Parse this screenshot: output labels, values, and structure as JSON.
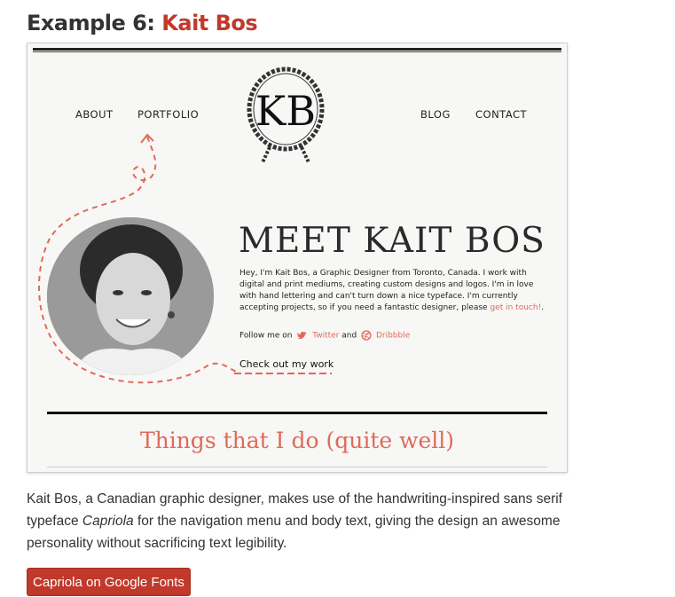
{
  "heading": {
    "prefix": "Example 6: ",
    "name": "Kait Bos"
  },
  "site": {
    "nav": {
      "about": "ABOUT",
      "portfolio": "PORTFOLIO",
      "blog": "BLOG",
      "contact": "CONTACT"
    },
    "logo_text": "KB",
    "meet_title": "MEET KAIT BOS",
    "bio_text": "Hey, I'm Kait Bos, a Graphic Designer from Toronto, Canada. I work with digital and print mediums, creating custom designs and logos. I'm in love with hand lettering and can't turn down a nice typeface. I'm currently accepting projects, so if you need a fantastic designer, please ",
    "bio_link": "get in touch!",
    "bio_end": ".",
    "follow_prefix": "Follow me on",
    "twitter_label": "Twitter",
    "and_word": "and",
    "dribbble_label": "Dribbble",
    "check_work": "Check out my work",
    "things_title": "Things that I do (quite well)",
    "accent_color": "#e06a5a"
  },
  "description": {
    "part1": "Kait Bos, a Canadian graphic designer, makes use of the handwriting-inspired sans serif typeface ",
    "typeface": "Capriola",
    "part2": " for the navigation menu and body text, giving the design an awesome personality without sacrificing text legibility."
  },
  "cta_button": "Capriola on Google Fonts",
  "brand_color": "#c0392b"
}
